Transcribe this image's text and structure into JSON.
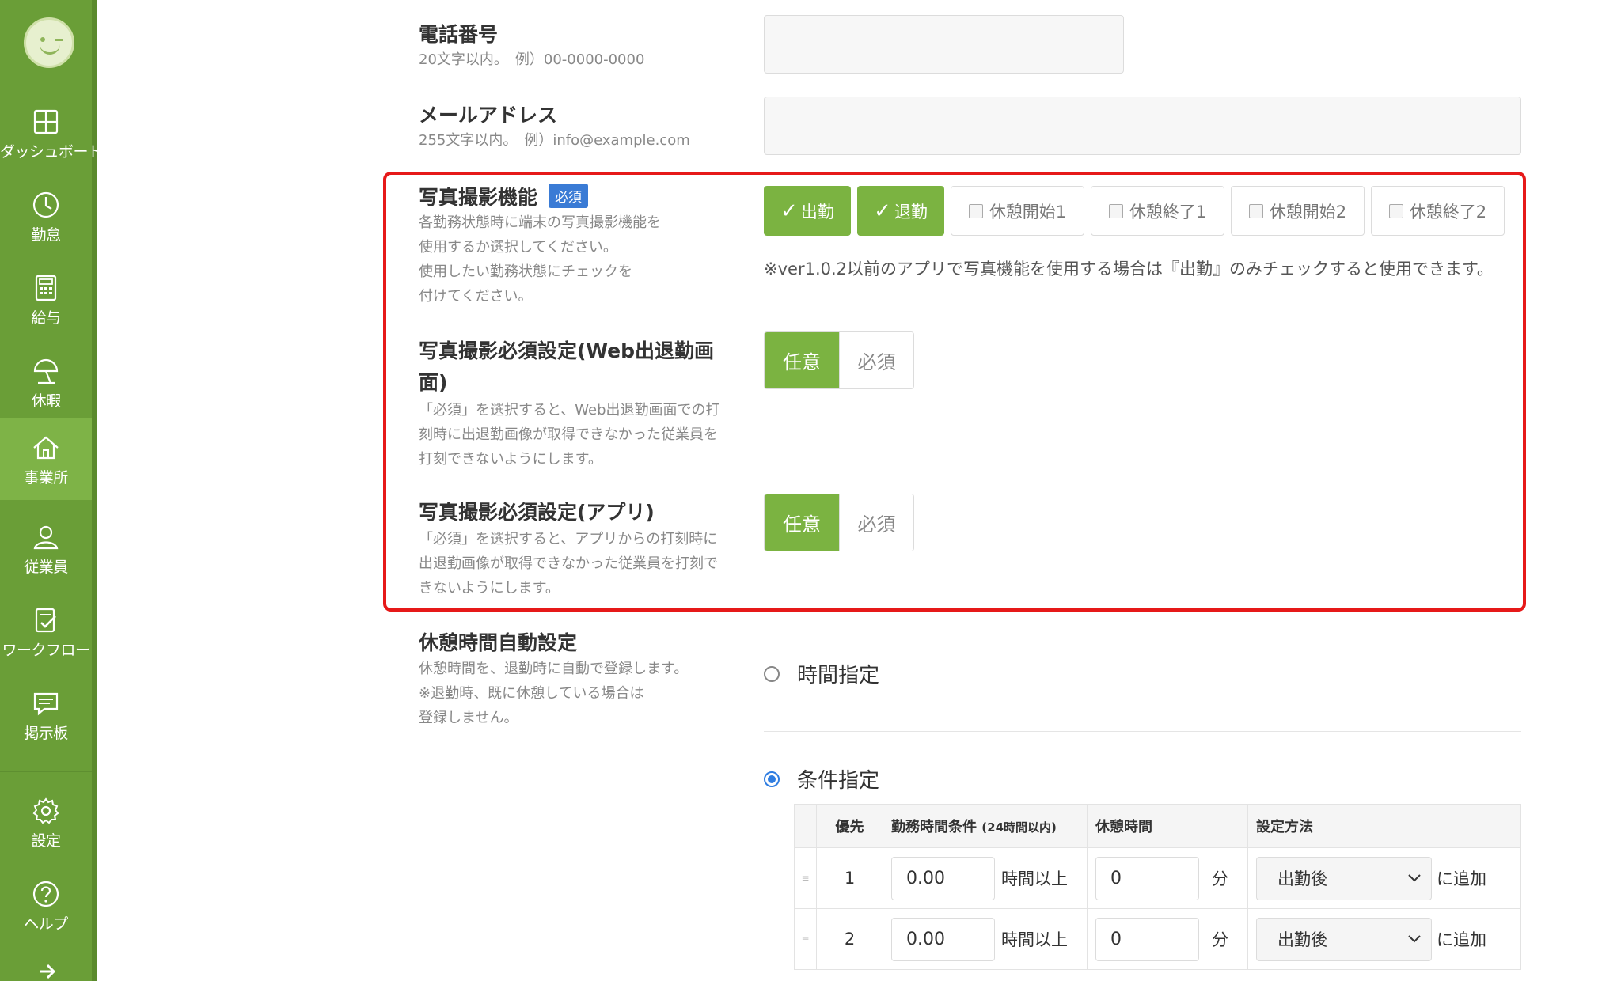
{
  "sidebar": {
    "items": [
      {
        "label": "ダッシュボード",
        "icon": "dashboard-icon"
      },
      {
        "label": "勤怠",
        "icon": "clock-icon"
      },
      {
        "label": "給与",
        "icon": "calculator-icon"
      },
      {
        "label": "休暇",
        "icon": "beach-umbrella-icon"
      },
      {
        "label": "事業所",
        "icon": "home-icon"
      },
      {
        "label": "従業員",
        "icon": "person-icon"
      },
      {
        "label": "ワークフロー",
        "icon": "checklist-icon"
      },
      {
        "label": "掲示板",
        "icon": "message-board-icon"
      },
      {
        "label": "設定",
        "icon": "gear-icon"
      },
      {
        "label": "ヘルプ",
        "icon": "help-icon"
      }
    ],
    "active": "事業所",
    "accent": "#6a9e37"
  },
  "form": {
    "phone": {
      "title": "電話番号",
      "desc": "20文字以内。　例）00-0000-0000"
    },
    "email": {
      "title": "メールアドレス",
      "desc": "255文字以内。　例）info@example.com"
    },
    "photo": {
      "title": "写真撮影機能",
      "badge": "必須",
      "desc": [
        "各勤務状態時に端末の写真撮影機能を",
        "使用するか選択してください。",
        "使用したい勤務状態にチェックを",
        "付けてください。"
      ],
      "options": [
        {
          "label": "出勤",
          "checked": true
        },
        {
          "label": "退勤",
          "checked": true
        },
        {
          "label": "休憩開始1",
          "checked": false
        },
        {
          "label": "休憩終了1",
          "checked": false
        },
        {
          "label": "休憩開始2",
          "checked": false
        },
        {
          "label": "休憩終了2",
          "checked": false
        }
      ],
      "note": "※ver1.0.2以前のアプリで写真機能を使用する場合は『出勤』のみチェックすると使用できます。"
    },
    "photo_web": {
      "title_line1": "写真撮影必須設定(Web出退勤画",
      "title_line2": "面)",
      "desc": [
        "「必須」を選択すると、Web出退勤画面での打",
        "刻時に出退勤画像が取得できなかった従業員を",
        "打刻できないようにします。"
      ],
      "options": [
        "任意",
        "必須"
      ],
      "selected": "任意"
    },
    "photo_app": {
      "title": "写真撮影必須設定(アプリ)",
      "desc": [
        "「必須」を選択すると、アプリからの打刻時に",
        "出退勤画像が取得できなかった従業員を打刻で",
        "きないようにします。"
      ],
      "options": [
        "任意",
        "必須"
      ],
      "selected": "任意"
    },
    "break_auto": {
      "title": "休憩時間自動設定",
      "desc": [
        "休憩時間を、退勤時に自動で登録します。",
        "※退勤時、既に休憩している場合は",
        "登録しません。"
      ],
      "radio_time": "時間指定",
      "radio_condition": "条件指定",
      "selected": "条件指定",
      "table": {
        "headers": {
          "priority": "優先",
          "condition": "勤務時間条件",
          "condition_note": "(24時間以内)",
          "break": "休憩時間",
          "method": "設定方法"
        },
        "rows": [
          {
            "priority": "1",
            "hours": "0.00",
            "hours_unit": "時間以上",
            "minutes": "0",
            "minutes_unit": "分",
            "method": "出勤後",
            "suffix": "に追加"
          },
          {
            "priority": "2",
            "hours": "0.00",
            "hours_unit": "時間以上",
            "minutes": "0",
            "minutes_unit": "分",
            "method": "出勤後",
            "suffix": "に追加"
          }
        ]
      }
    }
  },
  "colors": {
    "accent_green": "#7bb341",
    "badge_blue": "#3a7bd5",
    "highlight_red": "#e61919",
    "radio_blue": "#2f7de1"
  }
}
